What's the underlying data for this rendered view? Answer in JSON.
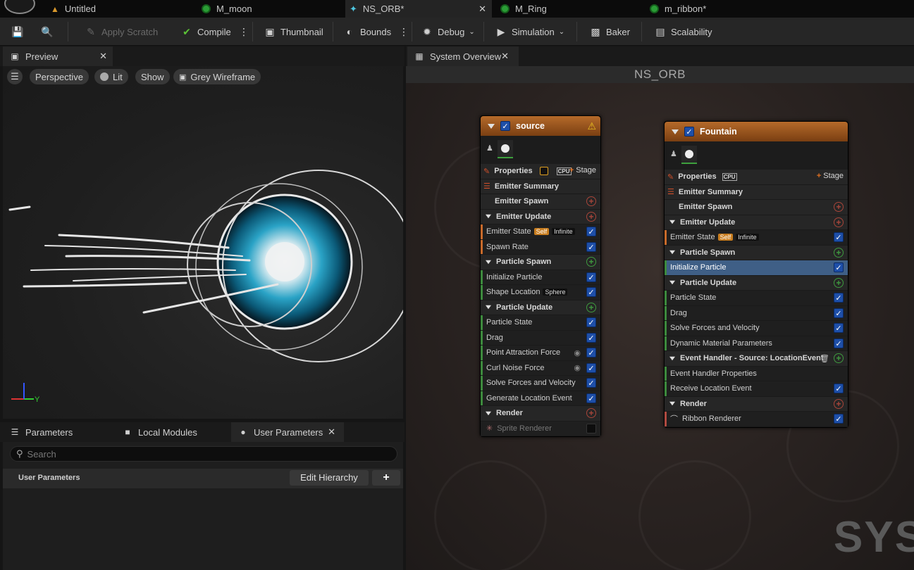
{
  "tabs": [
    {
      "label": "Untitled"
    },
    {
      "label": "M_moon"
    },
    {
      "label": "NS_ORB*",
      "active": true
    },
    {
      "label": "M_Ring"
    },
    {
      "label": "m_ribbon*"
    }
  ],
  "toolbar": {
    "apply_scratch": "Apply Scratch",
    "compile": "Compile",
    "thumbnail": "Thumbnail",
    "bounds": "Bounds",
    "debug": "Debug",
    "simulation": "Simulation",
    "baker": "Baker",
    "scalability": "Scalability"
  },
  "preview": {
    "tab": "Preview",
    "perspective": "Perspective",
    "lit": "Lit",
    "show": "Show",
    "grey_wireframe": "Grey Wireframe",
    "axis_y": "Y"
  },
  "params": {
    "tab_parameters": "Parameters",
    "tab_local_modules": "Local Modules",
    "tab_user_parameters": "User Parameters",
    "search_placeholder": "Search",
    "user_parameters_label": "User Parameters",
    "edit_hierarchy": "Edit Hierarchy"
  },
  "system_overview": {
    "tab": "System Overview",
    "title": "NS_ORB",
    "watermark_text": "SYST"
  },
  "nodes": {
    "source": {
      "name": "source",
      "properties": "Properties",
      "cpu": "CPU",
      "stage": "Stage",
      "emitter_summary": "Emitter Summary",
      "emitter_spawn": "Emitter Spawn",
      "emitter_update": "Emitter Update",
      "emitter_state": "Emitter State",
      "self": "Self",
      "infinite": "Infinite",
      "spawn_rate": "Spawn Rate",
      "particle_spawn": "Particle Spawn",
      "initialize_particle": "Initialize Particle",
      "shape_location": "Shape Location",
      "sphere": "Sphere",
      "particle_update": "Particle Update",
      "particle_state": "Particle State",
      "drag": "Drag",
      "point_attraction_force": "Point Attraction Force",
      "curl_noise_force": "Curl Noise Force",
      "solve_forces": "Solve Forces and Velocity",
      "generate_location_event": "Generate Location Event",
      "render": "Render",
      "sprite_renderer": "Sprite Renderer"
    },
    "fountain": {
      "name": "Fountain",
      "properties": "Properties",
      "cpu": "CPU",
      "stage": "Stage",
      "emitter_summary": "Emitter Summary",
      "emitter_spawn": "Emitter Spawn",
      "emitter_update": "Emitter Update",
      "emitter_state": "Emitter State",
      "self": "Self",
      "infinite": "Infinite",
      "particle_spawn": "Particle Spawn",
      "initialize_particle": "Initialize Particle",
      "particle_update": "Particle Update",
      "particle_state": "Particle State",
      "drag": "Drag",
      "solve_forces": "Solve Forces and Velocity",
      "dynamic_material_parameters": "Dynamic Material Parameters",
      "event_handler": "Event Handler - Source: LocationEvent",
      "event_handler_properties": "Event Handler Properties",
      "receive_location_event": "Receive Location Event",
      "render": "Render",
      "ribbon_renderer": "Ribbon Renderer"
    }
  }
}
